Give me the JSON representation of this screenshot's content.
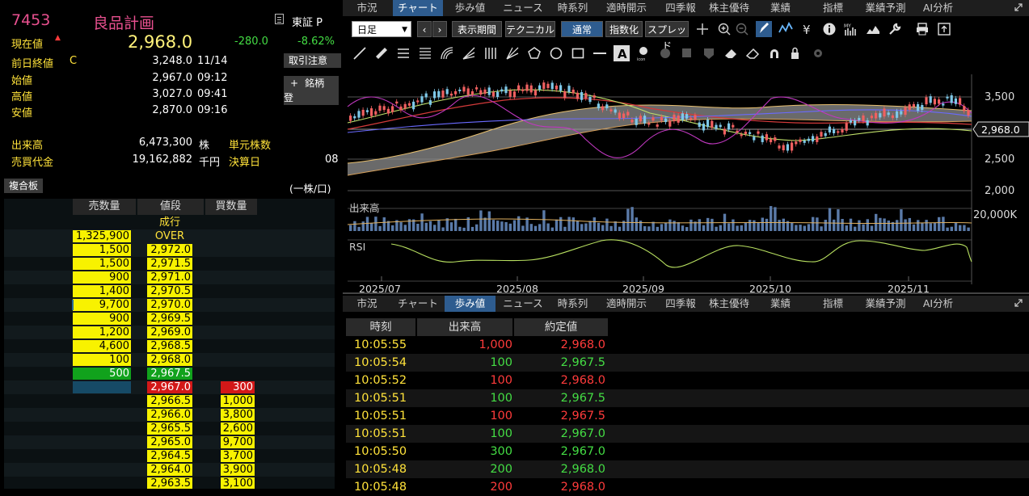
{
  "quote": {
    "code": "7453",
    "name": "良品計画",
    "market": "東証 P",
    "current_label": "現在値",
    "current_price": "2,968.0",
    "change": "-280.0",
    "change_pct": "-8.62%",
    "prev_close_label": "前日終値",
    "prev_close_flag": "C",
    "prev_close": "3,248.0",
    "prev_close_date": "11/14",
    "open_label": "始値",
    "open": "2,967.0",
    "open_time": "09:12",
    "high_label": "高値",
    "high": "3,027.0",
    "high_time": "09:41",
    "low_label": "安値",
    "low": "2,870.0",
    "low_time": "09:16",
    "volume_label": "出来高",
    "volume": "6,473,300",
    "volume_unit": "株",
    "unit_shares_label": "単元株数",
    "turnover_label": "売買代金",
    "turnover": "19,162,882",
    "turnover_unit": "千円",
    "settlement_label": "決算日",
    "settlement_value": "08",
    "trade_notice_button": "取引注意",
    "watchlist_button": "銘柄登",
    "watchlist_plus": "+",
    "combined_board_button": "複合板",
    "per_share_label": "(一株/口)"
  },
  "book": {
    "headers": [
      "売数量",
      "値段",
      "買数量"
    ],
    "market_order_label": "成行",
    "over_label": "OVER",
    "over_ask": "1,325,900",
    "rows": [
      {
        "ask": "1,500",
        "price": "2,972.0",
        "bid": "",
        "style": "ask"
      },
      {
        "ask": "1,500",
        "price": "2,971.5",
        "bid": "",
        "style": "ask"
      },
      {
        "ask": "900",
        "price": "2,971.0",
        "bid": "",
        "style": "ask"
      },
      {
        "ask": "1,400",
        "price": "2,970.5",
        "bid": "",
        "style": "ask"
      },
      {
        "ask": "9,700",
        "price": "2,970.0",
        "bid": "",
        "style": "ask"
      },
      {
        "ask": "900",
        "price": "2,969.5",
        "bid": "",
        "style": "ask"
      },
      {
        "ask": "1,200",
        "price": "2,969.0",
        "bid": "",
        "style": "ask"
      },
      {
        "ask": "4,600",
        "price": "2,968.5",
        "bid": "",
        "style": "ask"
      },
      {
        "ask": "100",
        "price": "2,968.0",
        "bid": "",
        "style": "ask"
      },
      {
        "ask": "500",
        "price": "2,967.5",
        "bid": "",
        "style": "green"
      },
      {
        "ask": "",
        "price": "2,967.0",
        "bid": "300",
        "style": "red"
      },
      {
        "ask": "",
        "price": "2,966.5",
        "bid": "1,000",
        "style": "bid"
      },
      {
        "ask": "",
        "price": "2,966.0",
        "bid": "3,800",
        "style": "bid"
      },
      {
        "ask": "",
        "price": "2,965.5",
        "bid": "2,600",
        "style": "bid"
      },
      {
        "ask": "",
        "price": "2,965.0",
        "bid": "9,700",
        "style": "bid"
      },
      {
        "ask": "",
        "price": "2,964.5",
        "bid": "3,700",
        "style": "bid"
      },
      {
        "ask": "",
        "price": "2,964.0",
        "bid": "3,900",
        "style": "bid"
      },
      {
        "ask": "",
        "price": "2,963.5",
        "bid": "3,100",
        "style": "bid"
      }
    ]
  },
  "tabs": [
    "市況",
    "チャート",
    "歩み値",
    "ニュース",
    "時系列",
    "適時開示",
    "四季報",
    "株主優待",
    "業績",
    "指標",
    "業績予測",
    "AI分析"
  ],
  "chart": {
    "period_select": "日足",
    "buttons": [
      "表示期間",
      "テクニカル",
      "通常",
      "指数化",
      "スプレッド"
    ],
    "price_ticks": [
      "3,500",
      "2,500",
      "2,000"
    ],
    "current_tag": "2,968.0",
    "volume_label": "出来高",
    "volume_tick": "20,000K",
    "rsi_label": "RSI",
    "x_ticks": [
      "2025/07",
      "2025/08",
      "2025/09",
      "2025/10",
      "2025/11"
    ]
  },
  "ticks": {
    "headers": [
      "時刻",
      "出来高",
      "約定値"
    ],
    "rows": [
      {
        "time": "10:05:55",
        "vol": "1,000",
        "price": "2,968.0",
        "dir": "red"
      },
      {
        "time": "10:05:54",
        "vol": "100",
        "price": "2,967.5",
        "dir": "green"
      },
      {
        "time": "10:05:52",
        "vol": "100",
        "price": "2,968.0",
        "dir": "red"
      },
      {
        "time": "10:05:51",
        "vol": "100",
        "price": "2,967.5",
        "dir": "green"
      },
      {
        "time": "10:05:51",
        "vol": "100",
        "price": "2,967.5",
        "dir": "red"
      },
      {
        "time": "10:05:51",
        "vol": "100",
        "price": "2,967.0",
        "dir": "green"
      },
      {
        "time": "10:05:50",
        "vol": "300",
        "price": "2,967.0",
        "dir": "green"
      },
      {
        "time": "10:05:48",
        "vol": "200",
        "price": "2,968.0",
        "dir": "green"
      },
      {
        "time": "10:05:48",
        "vol": "200",
        "price": "2,968.0",
        "dir": "red"
      }
    ]
  }
}
